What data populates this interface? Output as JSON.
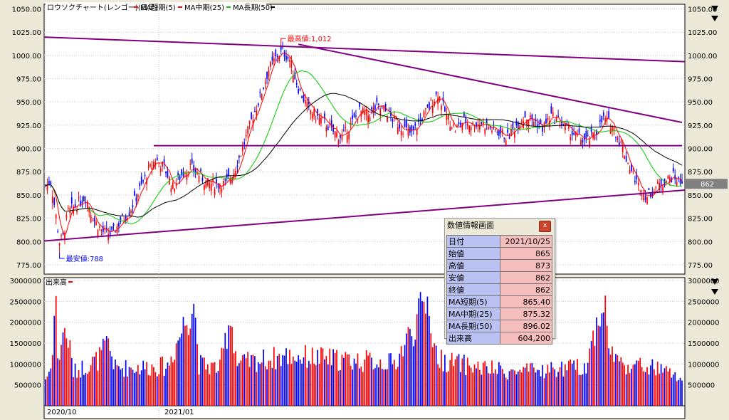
{
  "legend": {
    "candle": "ロウソクチャート(レンゴー)(日足)",
    "ma_short": "MA短期(5)",
    "ma_mid": "MA中期(25)",
    "ma_long": "MA長期(50)"
  },
  "volume_label": "出来高",
  "annotations": {
    "high": "最高値:1,012",
    "low": "最安値:788"
  },
  "current_price_label": "862",
  "dates": {
    "oct": "2020/10",
    "jan": "2021/01"
  },
  "price_ticks": [
    "1050.00",
    "1025.00",
    "1000.00",
    "975.00",
    "950.00",
    "925.00",
    "900.00",
    "875.00",
    "850.00",
    "825.00",
    "800.00",
    "775.00"
  ],
  "volume_ticks": [
    "3000000",
    "2500000",
    "2000000",
    "1500000",
    "1000000",
    "500000"
  ],
  "colors": {
    "up": "#ff0000",
    "down": "#0000ff",
    "ma_short": "#ff0000",
    "ma_mid": "#00cc00",
    "ma_long": "#000000",
    "trendline": "#800080",
    "bg": "#ffffff",
    "frame": "#ece9d8"
  },
  "info_panel": {
    "title": "数値情報画面",
    "close": "x",
    "rows": [
      {
        "label": "日付",
        "value": "2021/10/25"
      },
      {
        "label": "始値",
        "value": "865"
      },
      {
        "label": "高値",
        "value": "873"
      },
      {
        "label": "安値",
        "value": "862"
      },
      {
        "label": "終値",
        "value": "862"
      },
      {
        "label": "MA短期(5)",
        "value": "865.40"
      },
      {
        "label": "MA中期(25)",
        "value": "875.32"
      },
      {
        "label": "MA長期(50)",
        "value": "896.02"
      },
      {
        "label": "出来高",
        "value": "604,200"
      }
    ]
  },
  "chart_data": {
    "type": "candlestick",
    "price_axis": {
      "ylim": [
        765,
        1055
      ],
      "ticks": [
        1050,
        1025,
        1000,
        975,
        950,
        925,
        900,
        875,
        850,
        825,
        800,
        775
      ]
    },
    "volume_axis": {
      "ylim": [
        0,
        3000000
      ],
      "ticks": [
        3000000,
        2500000,
        2000000,
        1500000,
        1000000,
        500000
      ]
    },
    "anchors": [
      [
        0,
        860
      ],
      [
        3,
        865
      ],
      [
        5,
        840
      ],
      [
        8,
        800
      ],
      [
        10,
        805
      ],
      [
        13,
        832
      ],
      [
        18,
        840
      ],
      [
        23,
        848
      ],
      [
        28,
        822
      ],
      [
        33,
        810
      ],
      [
        38,
        808
      ],
      [
        43,
        822
      ],
      [
        48,
        832
      ],
      [
        53,
        852
      ],
      [
        58,
        872
      ],
      [
        63,
        888
      ],
      [
        68,
        880
      ],
      [
        73,
        858
      ],
      [
        78,
        872
      ],
      [
        83,
        880
      ],
      [
        88,
        872
      ],
      [
        93,
        862
      ],
      [
        98,
        862
      ],
      [
        103,
        862
      ],
      [
        108,
        875
      ],
      [
        113,
        900
      ],
      [
        118,
        930
      ],
      [
        123,
        955
      ],
      [
        128,
        985
      ],
      [
        133,
        1000
      ],
      [
        136,
        1005
      ],
      [
        140,
        995
      ],
      [
        145,
        965
      ],
      [
        150,
        945
      ],
      [
        155,
        935
      ],
      [
        160,
        928
      ],
      [
        165,
        918
      ],
      [
        170,
        912
      ],
      [
        175,
        925
      ],
      [
        180,
        940
      ],
      [
        185,
        936
      ],
      [
        190,
        945
      ],
      [
        195,
        940
      ],
      [
        200,
        930
      ],
      [
        205,
        922
      ],
      [
        210,
        915
      ],
      [
        215,
        930
      ],
      [
        220,
        945
      ],
      [
        225,
        960
      ],
      [
        230,
        935
      ],
      [
        235,
        920
      ],
      [
        240,
        930
      ],
      [
        245,
        925
      ],
      [
        250,
        928
      ],
      [
        255,
        922
      ],
      [
        260,
        918
      ],
      [
        265,
        912
      ],
      [
        270,
        925
      ],
      [
        275,
        935
      ],
      [
        280,
        930
      ],
      [
        285,
        922
      ],
      [
        290,
        935
      ],
      [
        295,
        928
      ],
      [
        300,
        920
      ],
      [
        305,
        912
      ],
      [
        310,
        908
      ],
      [
        315,
        915
      ],
      [
        320,
        932
      ],
      [
        325,
        925
      ],
      [
        330,
        905
      ],
      [
        335,
        880
      ],
      [
        340,
        860
      ],
      [
        345,
        848
      ],
      [
        350,
        858
      ],
      [
        355,
        865
      ],
      [
        360,
        870
      ],
      [
        365,
        862
      ]
    ],
    "volume_anchors": [
      [
        0,
        650000
      ],
      [
        3,
        900000
      ],
      [
        6,
        2700000
      ],
      [
        7,
        1000000
      ],
      [
        10,
        1800000
      ],
      [
        13,
        1600000
      ],
      [
        16,
        800000
      ],
      [
        25,
        1000000
      ],
      [
        30,
        1100000
      ],
      [
        36,
        1500000
      ],
      [
        40,
        900000
      ],
      [
        70,
        950000
      ],
      [
        85,
        2550000
      ],
      [
        88,
        1000000
      ],
      [
        100,
        900000
      ],
      [
        106,
        2200000
      ],
      [
        110,
        1000000
      ],
      [
        140,
        1200000
      ],
      [
        170,
        1100000
      ],
      [
        195,
        1050000
      ],
      [
        200,
        1000000
      ],
      [
        220,
        2600000
      ],
      [
        222,
        1500000
      ],
      [
        226,
        1100000
      ],
      [
        250,
        900000
      ],
      [
        270,
        800000
      ],
      [
        285,
        850000
      ],
      [
        300,
        900000
      ],
      [
        310,
        950000
      ],
      [
        320,
        2650000
      ],
      [
        323,
        1400000
      ],
      [
        330,
        1000000
      ],
      [
        350,
        900000
      ],
      [
        365,
        650000
      ]
    ],
    "ma_periods": {
      "short": 5,
      "mid": 25,
      "long": 50
    },
    "extremes": {
      "high": 1012,
      "low": 788
    },
    "last": {
      "date": "2021/10/25",
      "open": 865,
      "high": 873,
      "low": 862,
      "close": 862,
      "volume": 604200
    },
    "trendlines": [
      {
        "p1": [
          -5,
          1020
        ],
        "p2": [
          385,
          992
        ]
      },
      {
        "p1": [
          145,
          1012
        ],
        "p2": [
          365,
          928
        ]
      },
      {
        "p1": [
          62,
          903
        ],
        "p2": [
          365,
          903
        ]
      },
      {
        "p1": [
          -5,
          800
        ],
        "p2": [
          385,
          858
        ]
      }
    ],
    "x_labels": [
      {
        "i": 0,
        "text": "2020/10"
      },
      {
        "i": 65,
        "text": "2021/01"
      }
    ],
    "grid": true,
    "legend_position": "top-left"
  }
}
